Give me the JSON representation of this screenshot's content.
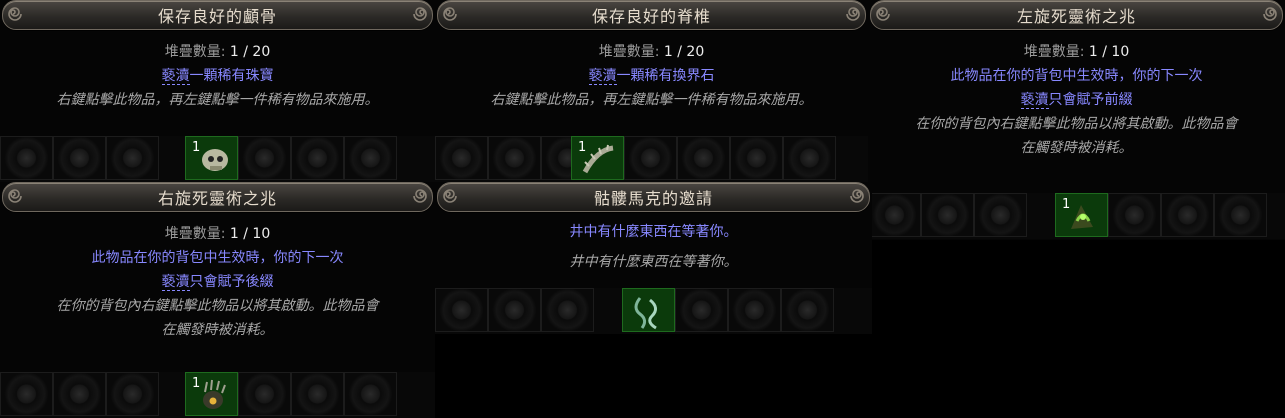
{
  "stack_label": "堆疊數量:",
  "tooltips": [
    {
      "title": "保存良好的顱骨",
      "stack_value": "1 / 20",
      "mod_lines": [
        {
          "pre": "褻瀆",
          "post": "一顆稀有珠寶"
        }
      ],
      "desc_lines": [
        "右鍵點擊此物品，再左鍵點擊一件稀有物品來施用。"
      ],
      "item_qty": "1",
      "item_icon": "skull-icon"
    },
    {
      "title": "保存良好的脊椎",
      "stack_value": "1 / 20",
      "mod_lines": [
        {
          "pre": "褻瀆",
          "post": "一顆稀有換界石"
        }
      ],
      "desc_lines": [
        "右鍵點擊此物品，再左鍵點擊一件稀有物品來施用。"
      ],
      "item_qty": "1",
      "item_icon": "spine-icon"
    },
    {
      "title": "左旋死靈術之兆",
      "stack_value": "1 / 10",
      "mod_lines": [
        {
          "pre": "",
          "post": "此物品在你的背包中生效時，你的下一次"
        },
        {
          "pre": "褻瀆",
          "post": "只會賦予前綴"
        }
      ],
      "desc_lines": [
        "在你的背包內右鍵點擊此物品以將其啟動。此物品會",
        "在觸發時被消耗。"
      ],
      "item_qty": "1",
      "item_icon": "omen-sinistral-icon"
    },
    {
      "title": "右旋死靈術之兆",
      "stack_value": "1 / 10",
      "mod_lines": [
        {
          "pre": "",
          "post": "此物品在你的背包中生效時，你的下一次"
        },
        {
          "pre": "褻瀆",
          "post": "只會賦予後綴"
        }
      ],
      "desc_lines": [
        "在你的背包內右鍵點擊此物品以將其啟動。此物品會",
        "在觸發時被消耗。"
      ],
      "item_qty": "1",
      "item_icon": "omen-dextral-icon"
    },
    {
      "title": "骷髏馬克的邀請",
      "stack_value": "",
      "mod_lines": [
        {
          "pre": "",
          "post": "井中有什麼東西在等著你。"
        }
      ],
      "desc_lines": [
        "井中有什麼東西在等著你。"
      ],
      "item_qty": "",
      "item_icon": "claw-invitation-icon"
    }
  ],
  "colors": {
    "magic_text": "#8888ff",
    "desc_text": "#a8a8a8",
    "title_text": "#e6dccd",
    "item_cell": "#0b3a0b"
  }
}
